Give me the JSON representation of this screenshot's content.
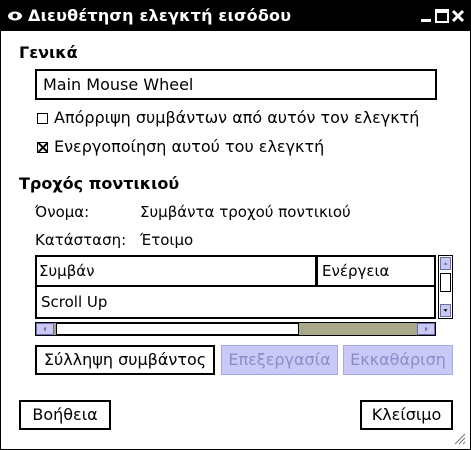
{
  "window": {
    "title": "Διευθέτηση ελεγκτή εισόδου",
    "icons": [
      "app-eye-icon",
      "minimize-icon",
      "maximize-icon",
      "close-icon"
    ]
  },
  "general": {
    "heading": "Γενικά",
    "name_value": "Main Mouse Wheel",
    "discard_events": {
      "label": "Απόρριψη συμβάντων από αυτόν τον ελεγκτή",
      "checked": false
    },
    "enable_controller": {
      "label": "Ενεργοποίηση αυτού του ελεγκτή",
      "checked": true
    }
  },
  "wheel": {
    "heading": "Τροχός ποντικιού",
    "name_label": "Όνομα:",
    "name_value": "Συμβάντα τροχού ποντικιού",
    "state_label": "Κατάσταση:",
    "state_value": "Έτοιμο"
  },
  "table": {
    "columns": [
      "Συμβάν",
      "Ενέργεια"
    ],
    "rows": [
      {
        "event": "Scroll Up",
        "action": ""
      }
    ]
  },
  "buttons": {
    "grab": "Σύλληψη συμβάντος",
    "edit": "Επεξεργασία",
    "clear": "Εκκαθάριση",
    "help": "Βοήθεια",
    "close": "Κλείσιμο"
  },
  "colors": {
    "titlebar": "#000000",
    "disabled_button": "#c9c9f7",
    "scroll_trough": "#a9a98a"
  }
}
